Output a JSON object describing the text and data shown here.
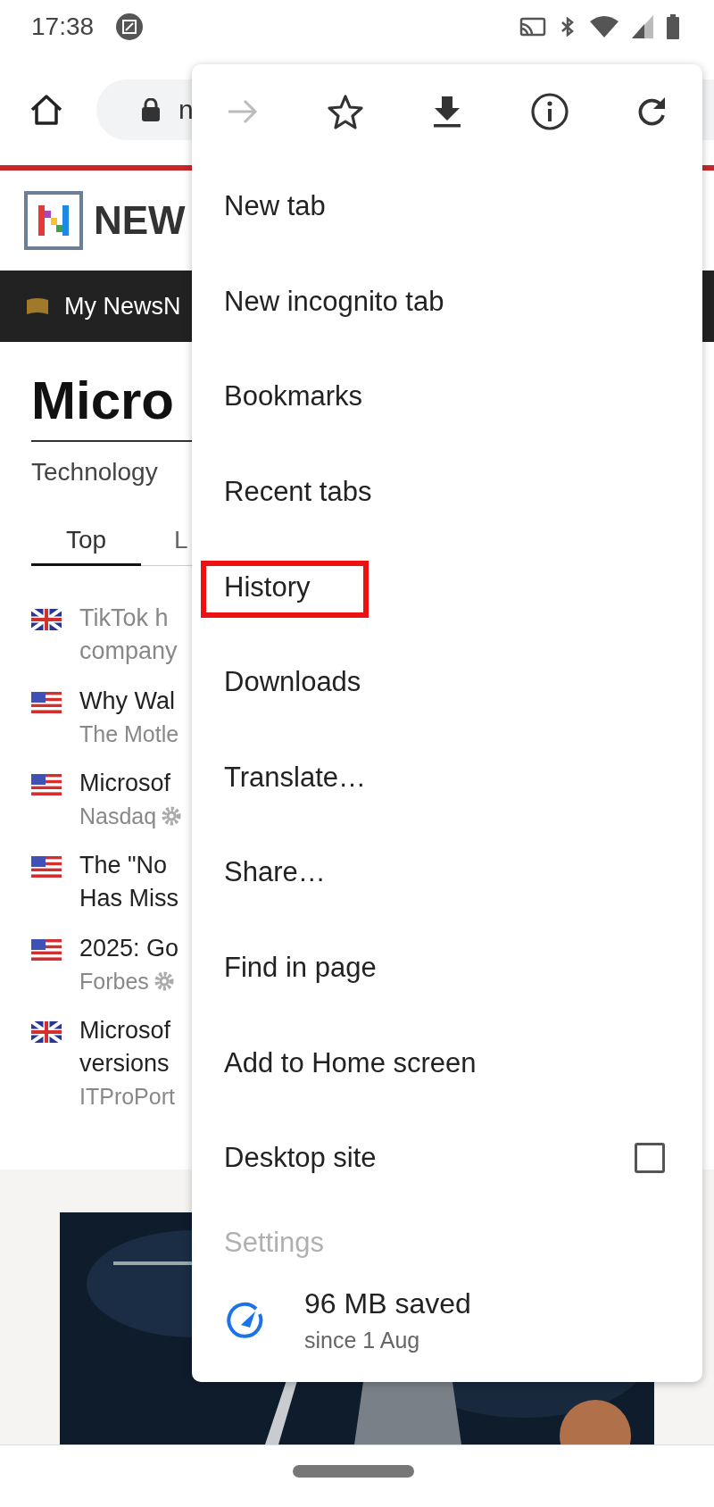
{
  "status_bar": {
    "time": "17:38"
  },
  "browser_toolbar": {
    "url": "n"
  },
  "site": {
    "logo_text": "NEW",
    "nav_label": "My NewsN",
    "title": "Micro",
    "category": "Technology",
    "tabs": [
      {
        "label": "Top",
        "selected": true
      },
      {
        "label": "L",
        "selected": false
      }
    ],
    "articles": [
      {
        "kind": "uk",
        "visited": true,
        "lines": [
          "TikTok h",
          "company"
        ]
      },
      {
        "kind": "us",
        "visited": false,
        "lines": [
          "Why Wal"
        ],
        "source": "The Motle",
        "gear": false
      },
      {
        "kind": "us",
        "visited": false,
        "lines": [
          "Microsof"
        ],
        "source": "Nasdaq",
        "gear": true
      },
      {
        "kind": "us",
        "visited": false,
        "lines": [
          "The \"No",
          "Has Miss"
        ]
      },
      {
        "kind": "us",
        "visited": false,
        "lines": [
          "2025: Go"
        ],
        "source": "Forbes",
        "gear": true
      },
      {
        "kind": "uk",
        "visited": false,
        "lines": [
          "Microsof",
          "versions"
        ],
        "source": "ITProPort",
        "gear": false
      }
    ]
  },
  "menu": {
    "forward_disabled": true,
    "items": [
      {
        "kind": "item",
        "label": "New tab",
        "highlighted": false
      },
      {
        "kind": "item",
        "label": "New incognito tab",
        "highlighted": false
      },
      {
        "kind": "item",
        "label": "Bookmarks",
        "highlighted": false
      },
      {
        "kind": "item",
        "label": "Recent tabs",
        "highlighted": false
      },
      {
        "kind": "item",
        "label": "History",
        "highlighted": true
      },
      {
        "kind": "item",
        "label": "Downloads",
        "highlighted": false
      },
      {
        "kind": "item",
        "label": "Translate…",
        "highlighted": false
      },
      {
        "kind": "item",
        "label": "Share…",
        "highlighted": false
      },
      {
        "kind": "item",
        "label": "Find in page",
        "highlighted": false
      },
      {
        "kind": "item",
        "label": "Add to Home screen",
        "highlighted": false
      },
      {
        "kind": "checkbox",
        "label": "Desktop site",
        "checked": false,
        "highlighted": false
      },
      {
        "kind": "faded",
        "label": "Settings",
        "highlighted": false
      }
    ],
    "data_saver": {
      "amount": "96 MB saved",
      "since": "since 1 Aug"
    }
  }
}
